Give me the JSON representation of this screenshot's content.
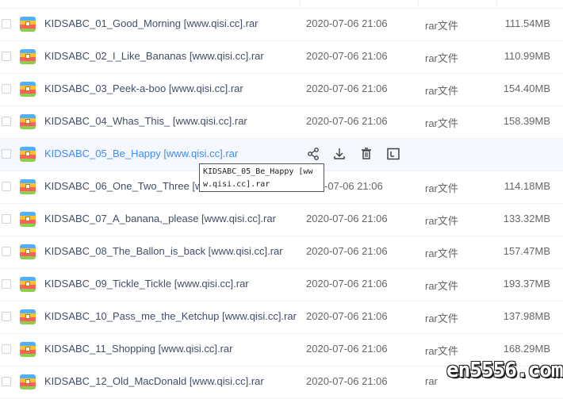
{
  "files": [
    {
      "name": "KIDSABC_01_Good_Morning [www.qisi.cc].rar",
      "date": "2020-07-06 21:06",
      "type": "rar文件",
      "size": "111.54MB"
    },
    {
      "name": "KIDSABC_02_I_Like_Bananas [www.qisi.cc].rar",
      "date": "2020-07-06 21:06",
      "type": "rar文件",
      "size": "110.99MB"
    },
    {
      "name": "KIDSABC_03_Peek-a-boo [www.qisi.cc].rar",
      "date": "2020-07-06 21:06",
      "type": "rar文件",
      "size": "154.40MB"
    },
    {
      "name": "KIDSABC_04_Whas_This_ [www.qisi.cc].rar",
      "date": "2020-07-06 21:06",
      "type": "rar文件",
      "size": "158.39MB"
    },
    {
      "name": "KIDSABC_05_Be_Happy [www.qisi.cc].rar",
      "date": "",
      "type": "",
      "size": ""
    },
    {
      "name": "KIDSABC_06_One_Two_Three [ww",
      "date": "-07-06 21:06",
      "type": "rar文件",
      "size": "114.18MB"
    },
    {
      "name": "KIDSABC_07_A_banana,_please [www.qisi.cc].rar",
      "date": "2020-07-06 21:06",
      "type": "rar文件",
      "size": "133.32MB"
    },
    {
      "name": "KIDSABC_08_The_Ballon_is_back [www.qisi.cc].rar",
      "date": "2020-07-06 21:06",
      "type": "rar文件",
      "size": "157.47MB"
    },
    {
      "name": "KIDSABC_09_Tickle_Tickle [www.qisi.cc].rar",
      "date": "2020-07-06 21:06",
      "type": "rar文件",
      "size": "193.37MB"
    },
    {
      "name": "KIDSABC_10_Pass_me_the_Ketchup [www.qisi.cc].rar",
      "date": "2020-07-06 21:06",
      "type": "rar文件",
      "size": "137.98MB"
    },
    {
      "name": "KIDSABC_11_Shopping [www.qisi.cc].rar",
      "date": "2020-07-06 21:06",
      "type": "rar文件",
      "size": "168.29MB"
    },
    {
      "name": "KIDSABC_12_Old_MacDonald [www.qisi.cc].rar",
      "date": "2020-07-06 21:06",
      "type": "rar",
      "size": ""
    }
  ],
  "tooltip": "KIDSABC_05_Be_Happy [www.qisi.cc].rar",
  "hover_row_actions": [
    "share-icon",
    "download-icon",
    "delete-icon",
    "rename-icon"
  ],
  "watermark": "en5556.com",
  "colors": {
    "accent": "#3b8cff",
    "hover_bg": "#f5f9ff"
  }
}
